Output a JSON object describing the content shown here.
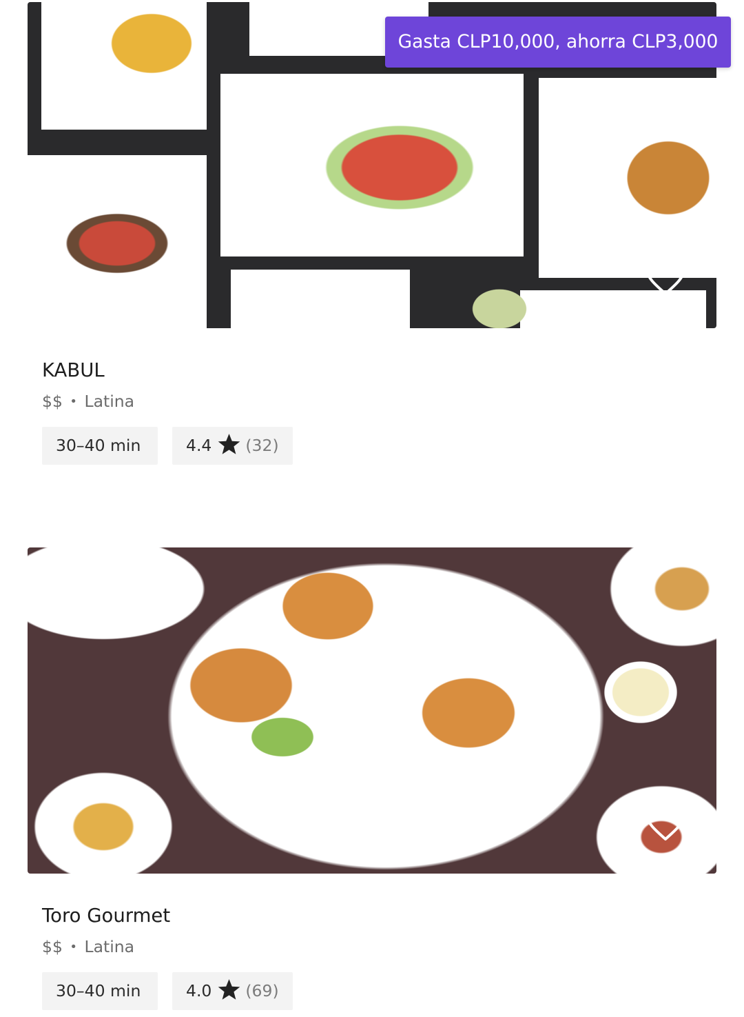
{
  "listings": [
    {
      "name": "KABUL",
      "price": "$$",
      "separator": "•",
      "cuisine": "Latina",
      "delivery_time": "30–40 min",
      "rating": "4.4",
      "review_count": "(32)",
      "promo": "Gasta CLP10,000, ahorra CLP3,000",
      "favorite_icon": "heart-outline-icon",
      "rating_icon": "star-icon"
    },
    {
      "name": "Toro Gourmet",
      "price": "$$",
      "separator": "•",
      "cuisine": "Latina",
      "delivery_time": "30–40 min",
      "rating": "4.0",
      "review_count": "(69)",
      "favorite_icon": "heart-outline-icon",
      "rating_icon": "star-icon"
    }
  ],
  "colors": {
    "promo_background": "#6e45d9",
    "pill_background": "#f3f3f3",
    "meta_text": "#6b6b6b"
  }
}
